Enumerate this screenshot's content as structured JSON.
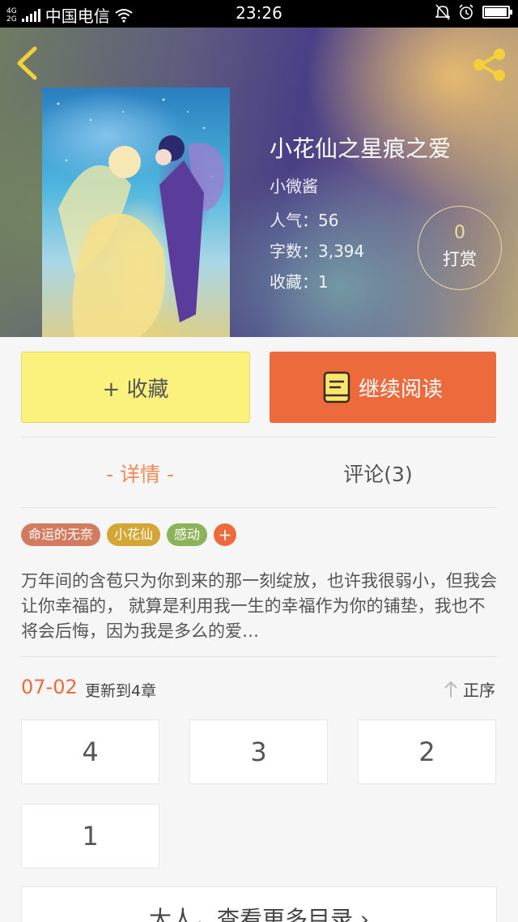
{
  "status_bar": {
    "net_top": "4G",
    "net_bottom": "2G",
    "carrier": "中国电信",
    "time": "23:26",
    "battery_level": 0.95
  },
  "header": {
    "title": "小花仙之星痕之爱",
    "author": "小微酱",
    "stats": [
      {
        "label": "人气：56"
      },
      {
        "label": "字数：3,394"
      },
      {
        "label": "收藏：1"
      }
    ],
    "reward": {
      "count": "0",
      "label": "打赏"
    }
  },
  "actions": {
    "collect_label": "+ 收藏",
    "read_label": "继续阅读"
  },
  "tabs": {
    "detail_label": "- 详情 -",
    "comment_label": "评论(3)"
  },
  "tags": [
    {
      "label": "命运的无奈",
      "color": "#d27b5f"
    },
    {
      "label": "小花仙",
      "color": "#d4a735"
    },
    {
      "label": "感动",
      "color": "#8db35a"
    }
  ],
  "tag_add": "+",
  "synopsis": "万年间的含苞只为你到来的那一刻绽放，也许我很弱小，但我会让你幸福的，  就算是利用我一生的幸福作为你的铺垫，我也不将会后悔，因为我是多么的爱…",
  "update": {
    "date": "07-02",
    "text": "更新到4章",
    "order_label": "正序"
  },
  "chapters": [
    "4",
    "3",
    "2",
    "1"
  ],
  "more_label": "大人，查看更多目录 ›",
  "colors": {
    "accent": "#ec6a3c",
    "collect_bg": "#fbf27e",
    "tab_active": "#f08a57"
  }
}
